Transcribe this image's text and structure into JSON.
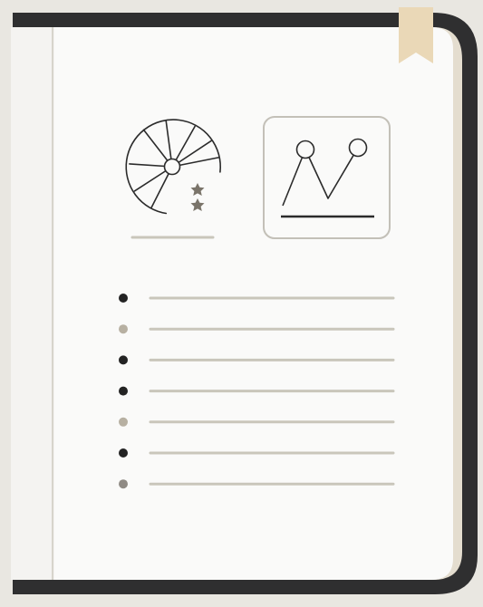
{
  "colors": {
    "background": "#e9e7e1",
    "back_page": "#e4ddcf",
    "page": "#fafaf9",
    "page_shadow": "#ece9e3",
    "spine_line": "#d7d4cc",
    "cover": "#2f2f30",
    "bookmark": "#ead8b7",
    "ink": "#2b2b2b",
    "muted_line": "#c9c6bb",
    "chart_frame": "#c3c0b8",
    "dot_dark": "#232323",
    "dot_light": "#b7b0a2",
    "dot_mid": "#8f8a84",
    "star": "#7a746a"
  },
  "icons": {
    "pie": "pie-chart-icon",
    "stars": "star-icon",
    "line_chart": "line-chart-icon",
    "bookmark": "bookmark-icon"
  },
  "list": {
    "bullets": [
      "dark",
      "light",
      "dark",
      "dark",
      "light",
      "dark",
      "mid"
    ]
  }
}
